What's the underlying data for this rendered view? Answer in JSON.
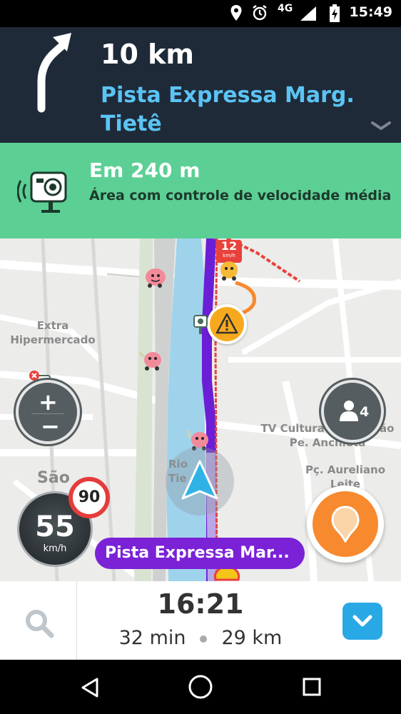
{
  "status_bar": {
    "network": "4G",
    "time": "15:49"
  },
  "navigation": {
    "distance": "10 km",
    "street_line1": "Pista Expressa Marg.",
    "street_line2": "Tietê",
    "turn_direction": "turn-right-arrow-icon"
  },
  "alert": {
    "title": "Em 240 m",
    "description": "Área com controle de velocidade média",
    "icon": "speed-camera-icon",
    "color": "#5ccf95"
  },
  "map": {
    "labels": {
      "extra_line1": "Extra",
      "extra_line2": "Hipermercado",
      "tv_line1": "TV Cultura - Fundação",
      "tv_line2": "Pe. Anchieta",
      "pc_line1": "Pç. Aureliano",
      "pc_line2": "Leite",
      "sao": "São",
      "rio_line1": "Rio",
      "rio_line2": "Tie"
    },
    "traffic_speed_value": "12",
    "traffic_speed_unit": "km/h",
    "zoom_plus": "+",
    "zoom_minus": "−",
    "wazers_count": "4",
    "speed": "55",
    "speed_unit": "km/h",
    "speed_limit": "90",
    "current_street": "Pista Expressa Mar...",
    "route_color": "#6a1fd6",
    "traffic_color": "#e8423b"
  },
  "bottom_bar": {
    "eta_time": "16:21",
    "duration": "32 min",
    "remaining_distance": "29 km"
  }
}
